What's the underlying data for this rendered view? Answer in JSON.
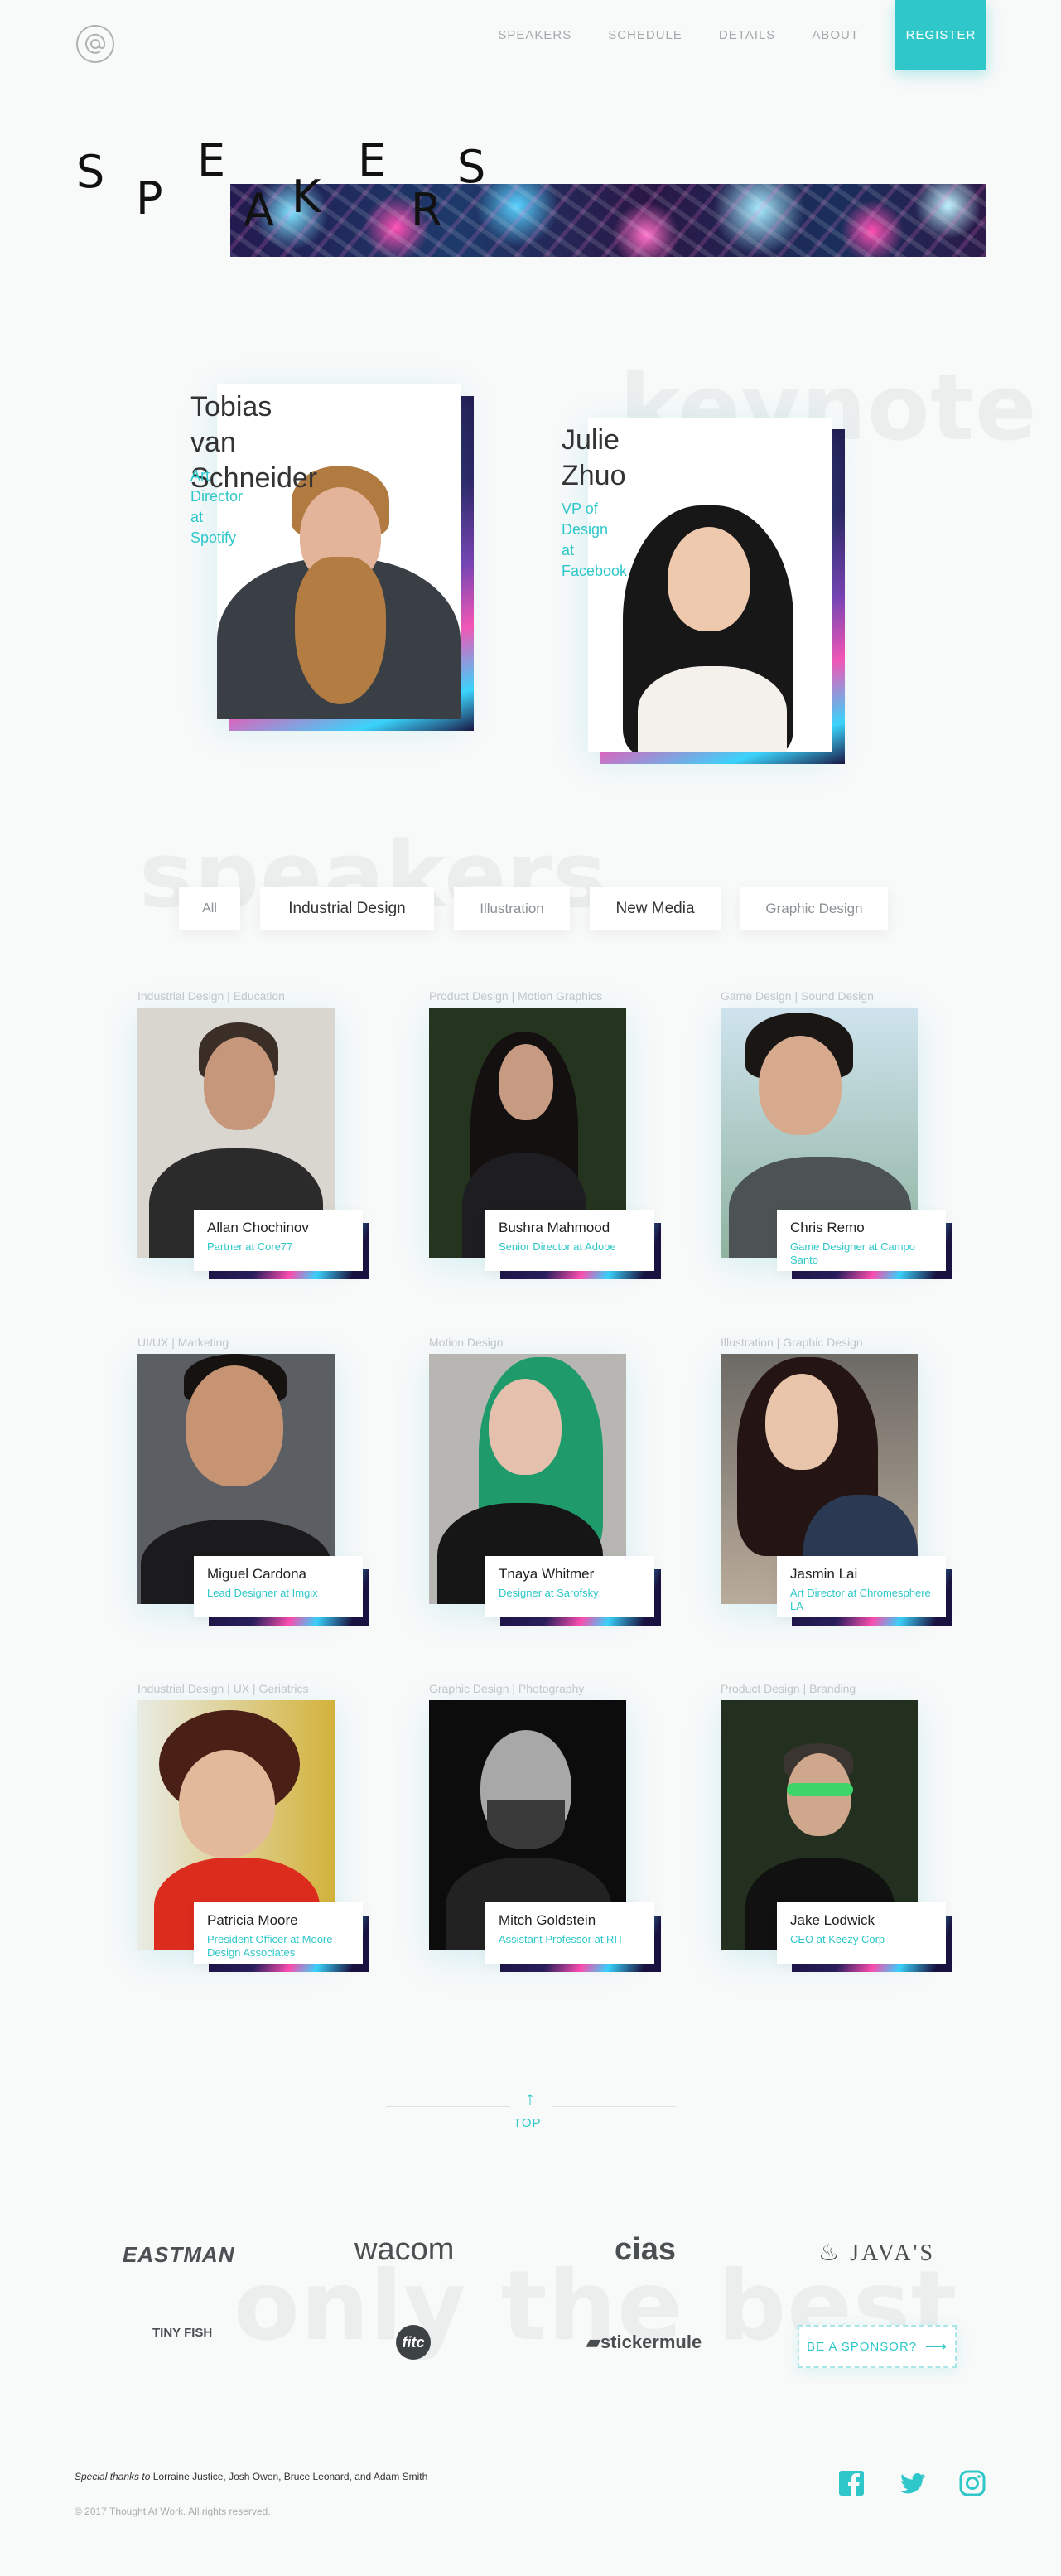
{
  "header": {
    "logo_icon": "at-sign-icon",
    "nav": [
      "SPEAKERS",
      "SCHEDULE",
      "DETAILS",
      "ABOUT"
    ],
    "register_label": "REGISTER"
  },
  "hero": {
    "letters": [
      "S",
      "P",
      "E",
      "A",
      "K",
      "E",
      "R",
      "S"
    ]
  },
  "keynote": {
    "ghost_text": "keynote",
    "speakers": [
      {
        "name_line1": "Tobias",
        "name_line2": "van Schneider",
        "role_line1": "Art Director",
        "role_line2": "at Spotify"
      },
      {
        "name_line1": "Julie",
        "name_line2": "Zhuo",
        "role_line1": "VP of Design",
        "role_line2": "at Facebook"
      }
    ]
  },
  "speakers_section": {
    "ghost_text": "speakers",
    "filters": [
      "All",
      "Industrial Design",
      "Illustration",
      "New Media",
      "Graphic Design"
    ],
    "speakers": [
      {
        "tags": "Industrial Design | Education",
        "name": "Allan Chochinov",
        "role": "Partner at Core77"
      },
      {
        "tags": "Product Design | Motion Graphics",
        "name": "Bushra Mahmood",
        "role": "Senior Director at Adobe"
      },
      {
        "tags": "Game Design | Sound Design",
        "name": "Chris Remo",
        "role": "Game Designer at Campo Santo"
      },
      {
        "tags": "UI/UX | Marketing",
        "name": "Miguel Cardona",
        "role": "Lead Designer at Imgix"
      },
      {
        "tags": "Motion Design",
        "name": "Tnaya Whitmer",
        "role": "Designer at Sarofsky"
      },
      {
        "tags": "Illustration | Graphic Design",
        "name": "Jasmin Lai",
        "role": "Art Director at Chromesphere LA"
      },
      {
        "tags": "Industrial Design | UX | Geriatrics",
        "name": "Patricia Moore",
        "role": "President Officer at Moore Design Associates"
      },
      {
        "tags": "Graphic Design | Photography",
        "name": "Mitch Goldstein",
        "role": "Assistant Professor at RIT"
      },
      {
        "tags": "Product Design | Branding",
        "name": "Jake Lodwick",
        "role": "CEO at Keezy Corp"
      }
    ]
  },
  "top_link": {
    "label": "TOP",
    "icon": "arrow-up-icon"
  },
  "sponsors": {
    "ghost_text": "only the best",
    "logos": [
      "EASTMAN",
      "wacom",
      "cias",
      "JAVA'S",
      "TINY FISH",
      "fitc",
      "stickermule"
    ],
    "cta_label": "BE A SPONSOR?",
    "cta_icon": "arrow-right-icon"
  },
  "footer": {
    "thanks_em": "Special thanks to",
    "thanks_rest": " Lorraine Justice, Josh Owen, Bruce Leonard, and Adam Smith",
    "copyright": "© 2017 Thought At Work. All rights reserved.",
    "social": [
      "facebook-icon",
      "twitter-icon",
      "instagram-icon"
    ]
  },
  "colors": {
    "accent": "#2fc7c9",
    "background": "#f8f9f9",
    "muted": "#a3a9ac"
  }
}
